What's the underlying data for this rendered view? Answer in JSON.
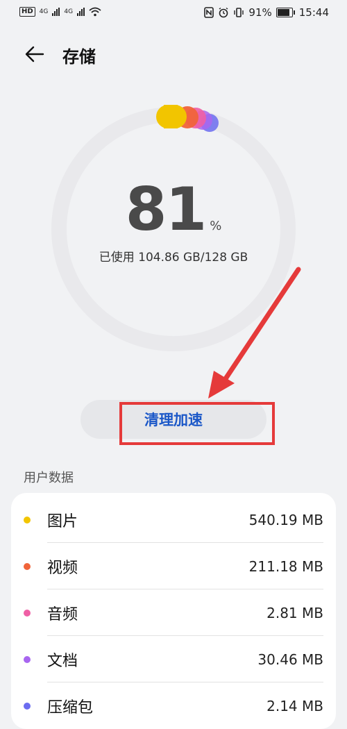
{
  "status_bar": {
    "network_left": "HD",
    "sim1": "4G",
    "sim2": "4G",
    "battery_percent": "91%",
    "time": "15:44"
  },
  "header": {
    "title": "存储",
    "back_icon": "arrow-left-icon"
  },
  "usage": {
    "percent_value": "81",
    "percent_sign": "%",
    "used_text": "已使用 104.86 GB/128 GB"
  },
  "actions": {
    "clean_label": "清理加速"
  },
  "section": {
    "user_data_label": "用户数据"
  },
  "items": [
    {
      "name": "图片",
      "size": "540.19 MB",
      "color": "#f2c500"
    },
    {
      "name": "视频",
      "size": "211.18 MB",
      "color": "#f0643a"
    },
    {
      "name": "音频",
      "size": "2.81 MB",
      "color": "#ef5fa5"
    },
    {
      "name": "文档",
      "size": "30.46 MB",
      "color": "#a866f0"
    },
    {
      "name": "压缩包",
      "size": "2.14 MB",
      "color": "#6b6cf0"
    }
  ],
  "colors": {
    "accent": "#1c58c8",
    "highlight": "#e53a3a",
    "ring_track": "#e9e9ec"
  }
}
